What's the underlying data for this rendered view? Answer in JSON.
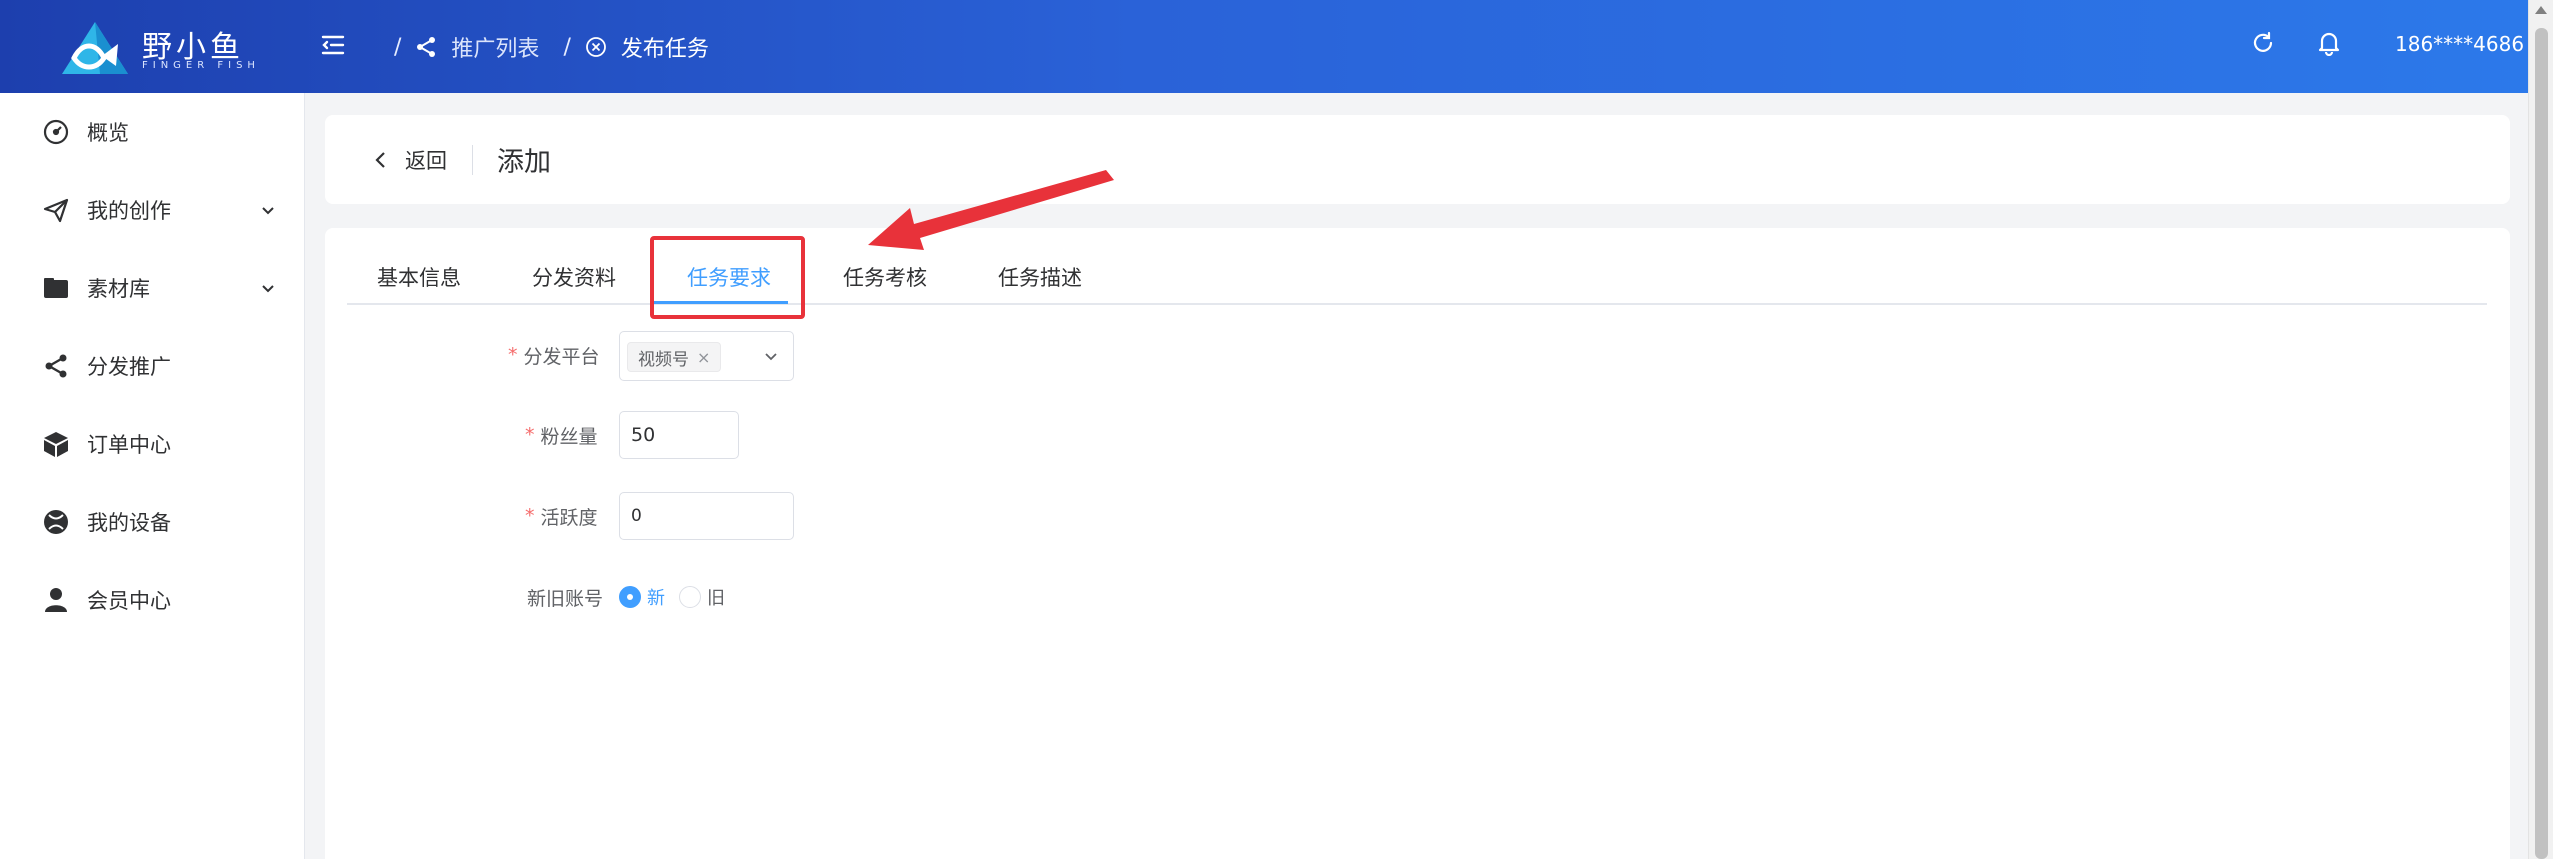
{
  "brand": {
    "name": "野小鱼",
    "subtitle": "FINGER FISH",
    "colors": {
      "header_start": "#1d3fae",
      "header_end": "#2c79ea",
      "primary": "#409eff",
      "required": "#f56c6c",
      "annotation": "#e8323a"
    }
  },
  "header": {
    "menu_icon": "menu-fold-icon",
    "breadcrumb": [
      {
        "label": "推广列表",
        "icon": "share-icon"
      },
      {
        "label": "发布任务",
        "icon": "close-circle-icon"
      }
    ],
    "separator": "/",
    "refresh_icon": "refresh-icon",
    "bell_icon": "bell-icon",
    "username": "186****4686"
  },
  "sidebar": {
    "items": [
      {
        "label": "概览",
        "icon": "dashboard-icon",
        "expandable": false
      },
      {
        "label": "我的创作",
        "icon": "send-icon",
        "expandable": true
      },
      {
        "label": "素材库",
        "icon": "folder-icon",
        "expandable": true
      },
      {
        "label": "分发推广",
        "icon": "share-icon",
        "expandable": false
      },
      {
        "label": "订单中心",
        "icon": "box-icon",
        "expandable": false
      },
      {
        "label": "我的设备",
        "icon": "device-icon",
        "expandable": false
      },
      {
        "label": "会员中心",
        "icon": "user-icon",
        "expandable": false
      }
    ]
  },
  "page_head": {
    "back_label": "返回",
    "title": "添加"
  },
  "tabs": {
    "items": [
      "基本信息",
      "分发资料",
      "任务要求",
      "任务考核",
      "任务描述"
    ],
    "active": "任务要求"
  },
  "form": {
    "platform": {
      "label": "分发平台",
      "required": true,
      "selected": "视频号"
    },
    "fans": {
      "label": "粉丝量",
      "required": true,
      "value": "50"
    },
    "activity": {
      "label": "活跃度",
      "required": true,
      "value": "0"
    },
    "account_age": {
      "label": "新旧账号",
      "required": false,
      "options": [
        "新",
        "旧"
      ],
      "selected": "新"
    }
  }
}
